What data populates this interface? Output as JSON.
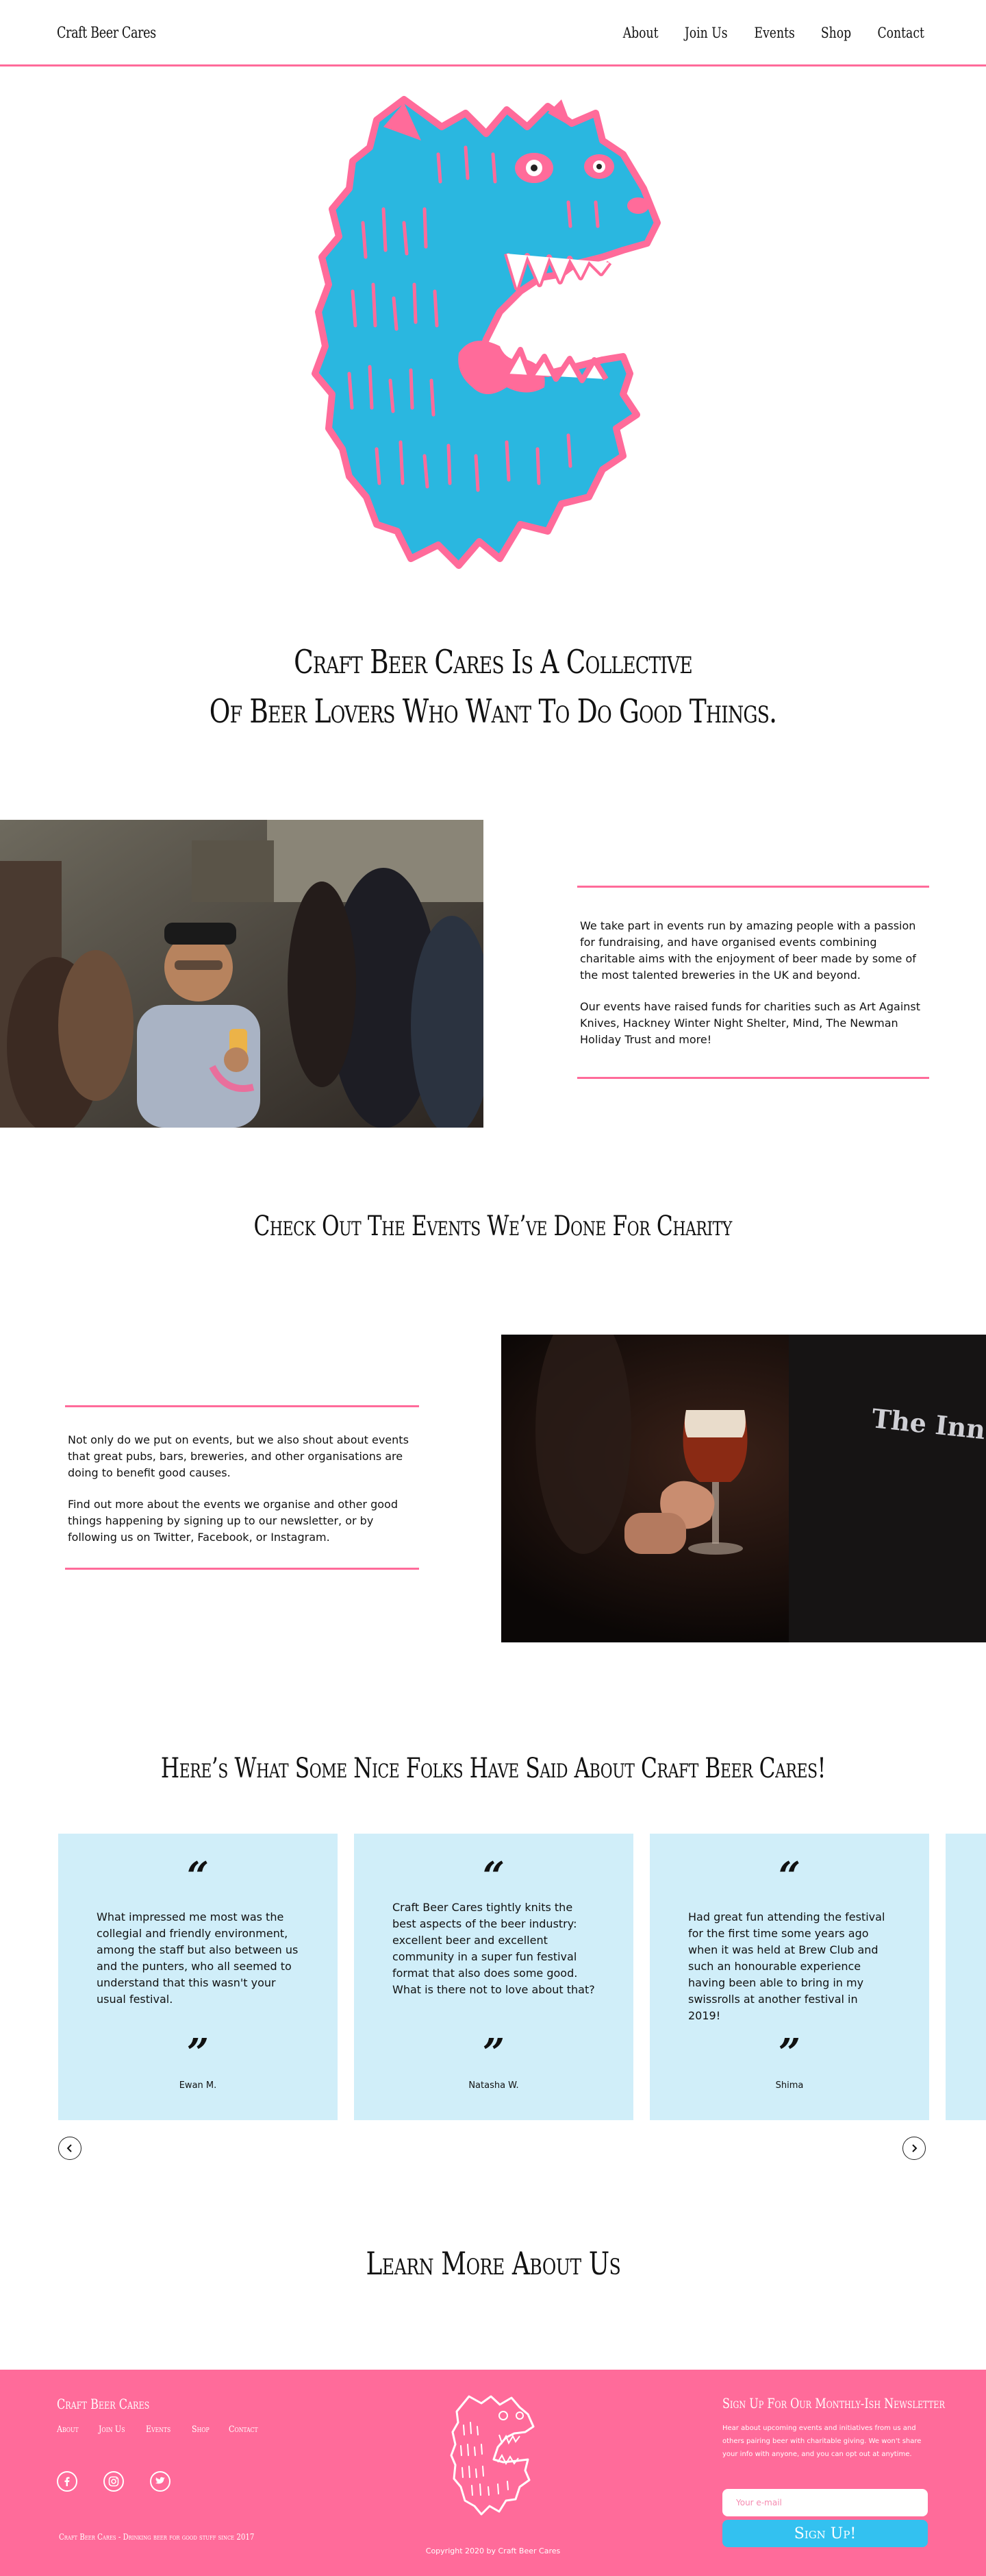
{
  "header": {
    "brand": "Craft Beer Cares",
    "nav": [
      "About",
      "Join Us",
      "Events",
      "Shop",
      "Contact"
    ]
  },
  "hero": {
    "tagline_line1": "Craft Beer Cares Is A Collective",
    "tagline_line2": "Of Beer Lovers Who Want To Do Good Things."
  },
  "about": {
    "para1": "We take part in events run by amazing people with a passion for fundraising, and have organised events combining charitable aims with the enjoyment of beer made by some of the most talented breweries in the UK and beyond.",
    "para2": "Our events have raised funds for charities such as Art Against Knives, Hackney Winter Night Shelter, Mind, The Newman Holiday Trust and more!"
  },
  "events": {
    "title": "Check Out The Events We’ve Done For Charity",
    "para1": "Not only do we put on events, but we also shout about events that great pubs, bars, breweries, and other organisations are doing to benefit good causes.",
    "para2": "Find out more about the events we organise and other good things happening by signing up to our newsletter, or by following us on Twitter, Facebook, or Instagram.",
    "photo_sign": "The Inn"
  },
  "testimonials": {
    "title": "Here’s What Some Nice Folks Have Said About Craft Beer Cares!",
    "items": [
      {
        "quote": "What impressed me most was the collegial and friendly environment, among the staff but also between us and the punters, who all seemed to understand that this wasn't your usual festival.",
        "author": "Ewan M."
      },
      {
        "quote": "Craft Beer Cares tightly knits the best aspects of the beer industry: excellent beer and excellent community in a super fun festival format that also does some good. What is there not to love about that?",
        "author": "Natasha W."
      },
      {
        "quote": "Had great fun attending the festival for the first time some years ago when it was held at Brew Club and such an honourable experience having been able to bring in my swissrolls at another festival in 2019!",
        "author": "Shima"
      }
    ],
    "open_mark": "“",
    "close_mark": "”"
  },
  "learn_more": "Learn More About Us",
  "footer": {
    "brand": "Craft Beer Cares",
    "nav": [
      "About",
      "Join Us",
      "Events",
      "Shop",
      "Contact"
    ],
    "tagline": "Craft Beer Cares - Drinking beer for good stuff since 2017",
    "copyright": "Copyright 2020 by Craft Beer Cares",
    "newsletter_title": "Sign Up For Our Monthly-Ish Newsletter",
    "newsletter_text": "Hear about upcoming events and initiatives from us and others pairing beer with charitable giving. We won't share your info with anyone, and you can opt out at anytime.",
    "email_placeholder": "Your e-mail",
    "signup_label": "Sign Up!"
  },
  "colors": {
    "pink": "#ff6b9a",
    "cyan": "#2ab7e0",
    "card_blue": "#d0eef9",
    "button_blue": "#33c1f0"
  }
}
